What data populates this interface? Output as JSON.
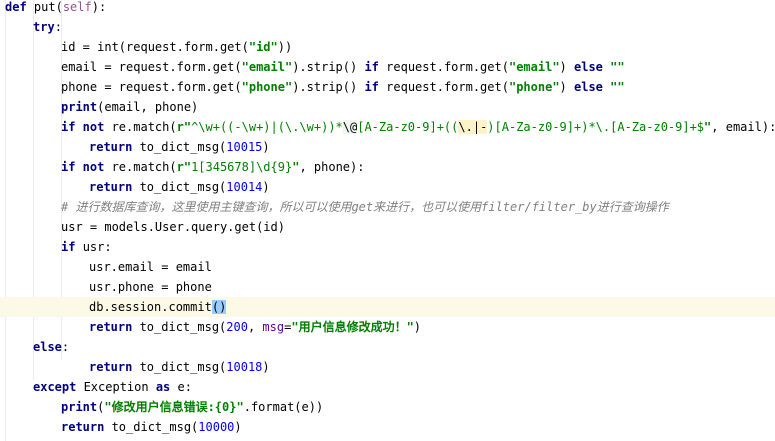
{
  "editor": {
    "language": "python",
    "current_line": 15,
    "lines": [
      {
        "indent": 0,
        "tokens": [
          [
            "kw",
            "def "
          ],
          [
            "fn",
            "put("
          ],
          [
            "self",
            "self"
          ],
          [
            "fn",
            "):"
          ]
        ]
      },
      {
        "indent": 1,
        "tokens": [
          [
            "kw",
            "try"
          ],
          [
            "fn",
            ":"
          ]
        ]
      },
      {
        "indent": 2,
        "tokens": [
          [
            "fn",
            "id = "
          ],
          [
            "fn",
            "int(request.form.get("
          ],
          [
            "str",
            "\"id\""
          ],
          [
            "fn",
            "))"
          ]
        ]
      },
      {
        "indent": 2,
        "tokens": [
          [
            "fn",
            "email = request.form.get("
          ],
          [
            "str",
            "\"email\""
          ],
          [
            "fn",
            ").strip() "
          ],
          [
            "kw",
            "if "
          ],
          [
            "fn",
            "request.form.get("
          ],
          [
            "str",
            "\"email\""
          ],
          [
            "fn",
            ") "
          ],
          [
            "kw",
            "else "
          ],
          [
            "str",
            "\"\""
          ]
        ]
      },
      {
        "indent": 2,
        "tokens": [
          [
            "fn",
            "phone = request.form.get("
          ],
          [
            "str",
            "\"phone\""
          ],
          [
            "fn",
            ").strip() "
          ],
          [
            "kw",
            "if "
          ],
          [
            "fn",
            "request.form.get("
          ],
          [
            "str",
            "\"phone\""
          ],
          [
            "fn",
            ") "
          ],
          [
            "kw",
            "else "
          ],
          [
            "str",
            "\"\""
          ]
        ]
      },
      {
        "indent": 2,
        "tokens": [
          [
            "kw",
            "print"
          ],
          [
            "fn",
            "(email, phone)"
          ]
        ]
      },
      {
        "indent": 2,
        "tokens": [
          [
            "kw",
            "if not "
          ],
          [
            "fn",
            "re.match("
          ],
          [
            "str",
            "r\""
          ],
          [
            "rx",
            "^\\w+((-\\w+)|(\\.\\w+))*"
          ],
          [
            "rxhl",
            "\\@"
          ],
          [
            "rx",
            "[A-Za-z0-9]+(("
          ],
          [
            "rxq",
            "\\.|-"
          ],
          [
            "rx",
            ")[A-Za-z0-9]+)*\\.[A-Za-z0-9]+$"
          ],
          [
            "str",
            "\""
          ],
          [
            "fn",
            ", email):"
          ]
        ]
      },
      {
        "indent": 3,
        "tokens": [
          [
            "kw",
            "return "
          ],
          [
            "fn",
            "to_dict_msg("
          ],
          [
            "num",
            "10015"
          ],
          [
            "fn",
            ")"
          ]
        ]
      },
      {
        "indent": 2,
        "tokens": [
          [
            "kw",
            "if not "
          ],
          [
            "fn",
            "re.match("
          ],
          [
            "str",
            "r\""
          ],
          [
            "rx",
            "1[345678]\\d{9}"
          ],
          [
            "str",
            "\""
          ],
          [
            "fn",
            ", phone):"
          ]
        ]
      },
      {
        "indent": 3,
        "tokens": [
          [
            "kw",
            "return "
          ],
          [
            "fn",
            "to_dict_msg("
          ],
          [
            "num",
            "10014"
          ],
          [
            "fn",
            ")"
          ]
        ]
      },
      {
        "indent": 2,
        "tokens": [
          [
            "cmt",
            "# 进行数据库查询，这里使用主键查询，所以可以使用get来进行，也可以使用filter/filter_by进行查询操作"
          ]
        ]
      },
      {
        "indent": 2,
        "tokens": [
          [
            "fn",
            "usr = models.User.query.get(id)"
          ]
        ]
      },
      {
        "indent": 2,
        "tokens": [
          [
            "kw",
            "if "
          ],
          [
            "fn",
            "usr:"
          ]
        ]
      },
      {
        "indent": 3,
        "tokens": [
          [
            "fn",
            "usr.email = email"
          ]
        ]
      },
      {
        "indent": 3,
        "tokens": [
          [
            "fn",
            "usr.phone = phone"
          ]
        ]
      },
      {
        "indent": 3,
        "tokens": [
          [
            "fn",
            "db.session.commit"
          ],
          [
            "brhl",
            "("
          ],
          [
            "brhl",
            ")"
          ]
        ]
      },
      {
        "indent": 3,
        "tokens": [
          [
            "kw",
            "return "
          ],
          [
            "fn",
            "to_dict_msg("
          ],
          [
            "num",
            "200"
          ],
          [
            "fn",
            ", "
          ],
          [
            "kwarg",
            "msg"
          ],
          [
            "fn",
            "="
          ],
          [
            "str",
            "\"用户信息修改成功！\""
          ],
          [
            "fn",
            ")"
          ]
        ]
      },
      {
        "indent": 1,
        "tokens": [
          [
            "kw",
            "else"
          ],
          [
            "fn",
            ":"
          ]
        ]
      },
      {
        "indent": 3,
        "tokens": [
          [
            "kw",
            "return "
          ],
          [
            "fn",
            "to_dict_msg("
          ],
          [
            "num",
            "10018"
          ],
          [
            "fn",
            ")"
          ]
        ]
      },
      {
        "indent": 1,
        "tokens": [
          [
            "kw",
            "except "
          ],
          [
            "fn",
            "Exception "
          ],
          [
            "kw",
            "as "
          ],
          [
            "fn",
            "e:"
          ]
        ]
      },
      {
        "indent": 2,
        "tokens": [
          [
            "kw",
            "print"
          ],
          [
            "fn",
            "("
          ],
          [
            "str",
            "\"修改用户信息错误:{0}\""
          ],
          [
            "fn",
            ".format(e))"
          ]
        ]
      },
      {
        "indent": 2,
        "tokens": [
          [
            "kw",
            "return "
          ],
          [
            "fn",
            "to_dict_msg("
          ],
          [
            "num",
            "10000"
          ],
          [
            "fn",
            ")"
          ]
        ]
      }
    ]
  }
}
